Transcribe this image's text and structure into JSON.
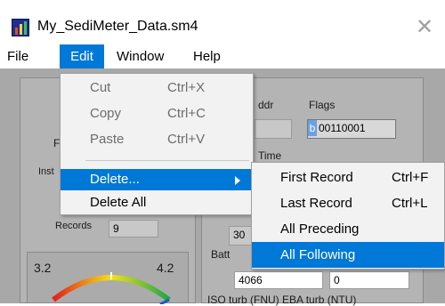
{
  "window": {
    "title": "My_SediMeter_Data.sm4",
    "close_glyph": "✕"
  },
  "menubar": {
    "items": [
      {
        "label": "File"
      },
      {
        "label": "Edit"
      },
      {
        "label": "Window"
      },
      {
        "label": "Help"
      }
    ]
  },
  "edit_menu": {
    "items": [
      {
        "label": "Cut",
        "shortcut": "Ctrl+X",
        "enabled": false
      },
      {
        "label": "Copy",
        "shortcut": "Ctrl+C",
        "enabled": false
      },
      {
        "label": "Paste",
        "shortcut": "Ctrl+V",
        "enabled": false
      },
      {
        "label": "Delete...",
        "shortcut": "",
        "enabled": true,
        "submenu": true
      },
      {
        "label": "Delete All",
        "shortcut": "",
        "enabled": true
      }
    ]
  },
  "delete_submenu": {
    "items": [
      {
        "label": "First Record",
        "shortcut": "Ctrl+F"
      },
      {
        "label": "Last Record",
        "shortcut": "Ctrl+L"
      },
      {
        "label": "All Preceding",
        "shortcut": ""
      },
      {
        "label": "All Following",
        "shortcut": ""
      }
    ]
  },
  "background_panel": {
    "addr_label": "ddr",
    "flags_label": "Flags",
    "flags_prefix": "b",
    "flags_value": "00110001",
    "time_label": "Time",
    "time_value": "30",
    "batt_label": "Batt",
    "batt_value": "4066",
    "second_value": "0",
    "turb_label": "ISO turb (FNU) EBA turb (NTU)",
    "left_label_f": "F",
    "left_label_inst": "Inst",
    "records_label": "Records",
    "records_value": "9",
    "gauge_min": "3.2",
    "gauge_max": "4.2"
  },
  "colors": {
    "accent": "#0078d7",
    "disabled_text": "#6d6d6d"
  }
}
